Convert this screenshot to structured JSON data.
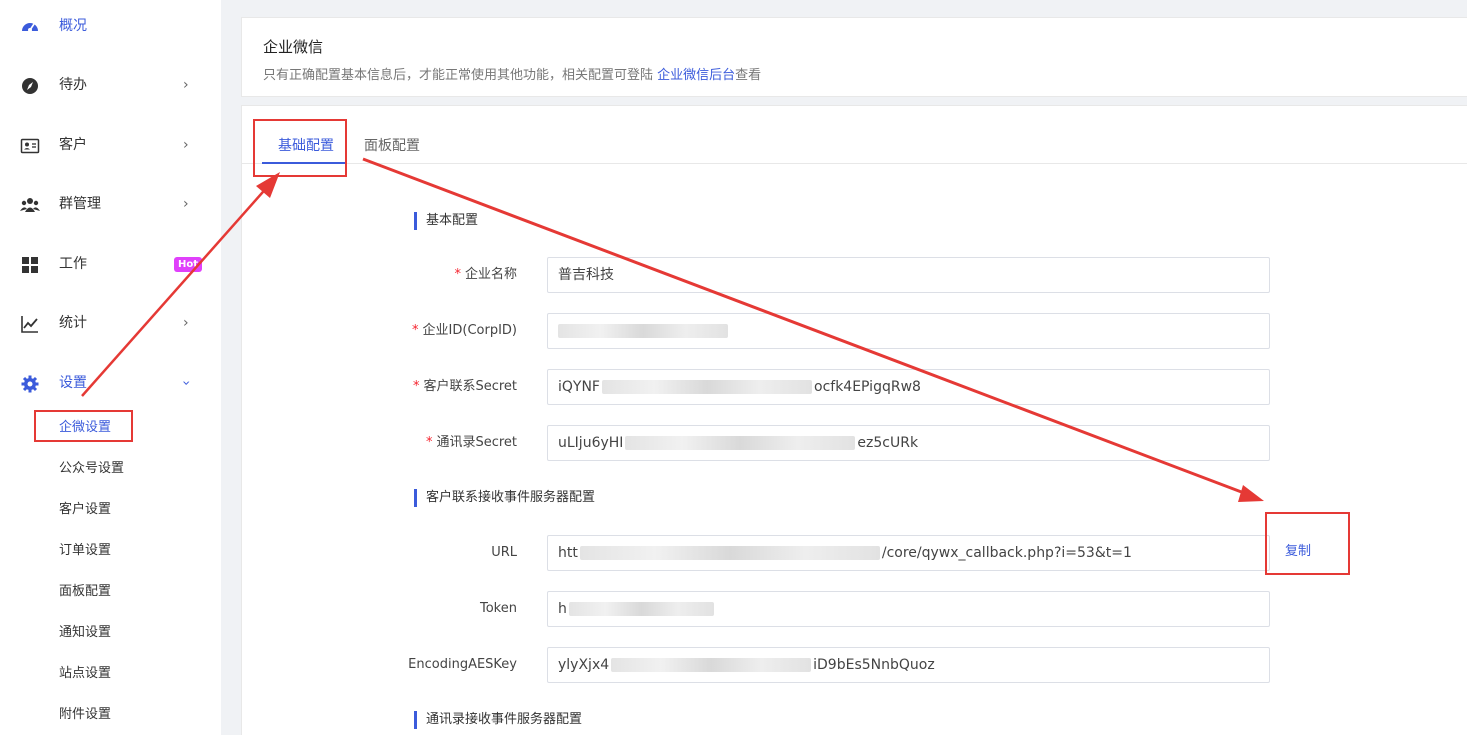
{
  "sidebar": {
    "items": [
      {
        "label": "概况",
        "icon": "dashboard-icon"
      },
      {
        "label": "待办",
        "icon": "compass-icon"
      },
      {
        "label": "客户",
        "icon": "contact-card-icon"
      },
      {
        "label": "群管理",
        "icon": "group-icon"
      },
      {
        "label": "工作",
        "icon": "grid-icon",
        "badge": "Hot"
      },
      {
        "label": "统计",
        "icon": "chart-line-icon"
      },
      {
        "label": "设置",
        "icon": "gear-icon"
      }
    ],
    "settings_sub": [
      "企微设置",
      "公众号设置",
      "客户设置",
      "订单设置",
      "面板配置",
      "通知设置",
      "站点设置",
      "附件设置"
    ]
  },
  "header": {
    "title": "企业微信",
    "desc_prefix": "只有正确配置基本信息后，才能正常使用其他功能，相关配置可登陆 ",
    "desc_link": "企业微信后台",
    "desc_suffix": "查看"
  },
  "tabs": [
    "基础配置",
    "面板配置"
  ],
  "sections": {
    "basic": "基本配置",
    "customer_event": "客户联系接收事件服务器配置",
    "contacts_event": "通讯录接收事件服务器配置"
  },
  "fields": {
    "corp_name": {
      "label": "企业名称",
      "value": "普吉科技"
    },
    "corp_id": {
      "label": "企业ID(CorpID)"
    },
    "customer_secret": {
      "label": "客户联系Secret",
      "value_start": "iQYNF",
      "value_end": "ocfk4EPigqRw8"
    },
    "contacts_secret": {
      "label": "通讯录Secret",
      "value_start": "uLIju6yHI",
      "value_end": "ez5cURk"
    },
    "url": {
      "label": "URL",
      "value_start": "htt",
      "value_end": "/core/qywx_callback.php?i=53&t=1"
    },
    "token": {
      "label": "Token",
      "value_start": "h"
    },
    "aes_key": {
      "label": "EncodingAESKey",
      "value_start": "ylyXjx4",
      "value_end": "iD9bEs5NnbQuoz"
    }
  },
  "copy_label": "复制",
  "colors": {
    "accent": "#3b5bdb",
    "required": "#f5222d",
    "annotation": "#e53935",
    "hot_badge": "#e040fb"
  }
}
